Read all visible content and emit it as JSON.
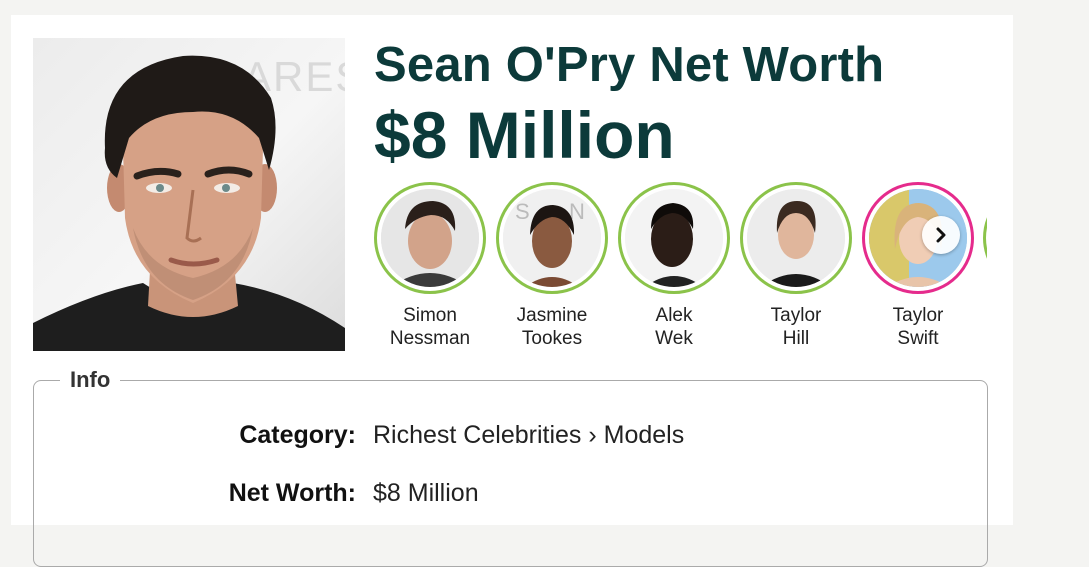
{
  "page": {
    "title": "Sean O'Pry Net Worth",
    "net_worth_heading": "$8 Million",
    "photo_background_text": "ARES"
  },
  "related": {
    "items": [
      {
        "first": "Simon",
        "last": "Nessman"
      },
      {
        "first": "Jasmine",
        "last": "Tookes"
      },
      {
        "first": "Alek",
        "last": "Wek"
      },
      {
        "first": "Taylor",
        "last": "Hill"
      },
      {
        "first": "Taylor",
        "last": "Swift"
      }
    ],
    "next_icon": "chevron-right-icon",
    "ring_color": "#8bc34a",
    "highlight_ring_color": "#e52b8c"
  },
  "info": {
    "legend": "Info",
    "rows": [
      {
        "label": "Category:",
        "value": "Richest Celebrities › Models"
      },
      {
        "label": "Net Worth:",
        "value": "$8 Million"
      }
    ]
  },
  "colors": {
    "heading": "#0c3a3a",
    "page_background": "#f4f4f2"
  }
}
